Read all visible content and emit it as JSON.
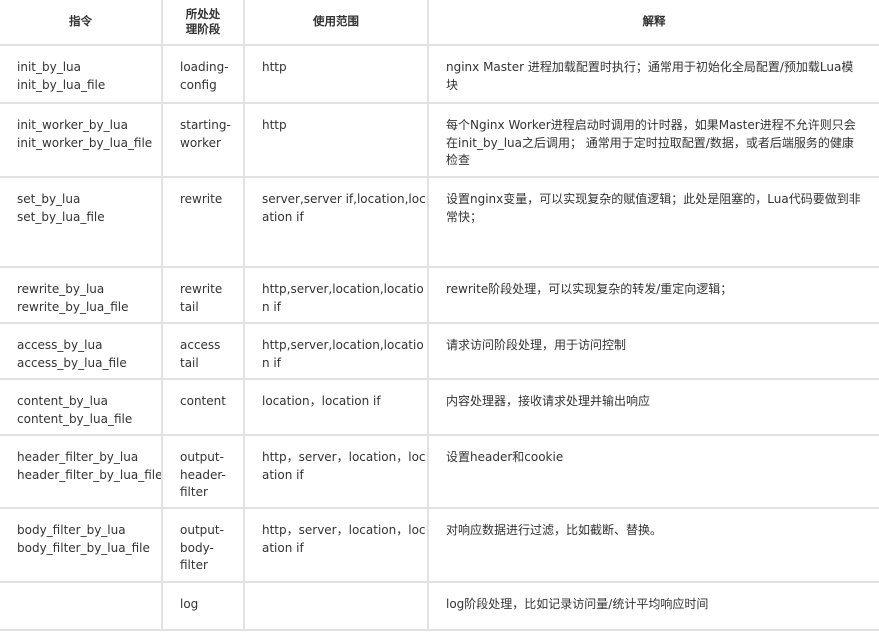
{
  "headers": {
    "directive": "指令",
    "phase": "所处处\n理阶段",
    "scope": "使用范围",
    "explain": "解释"
  },
  "rows": [
    {
      "d1": "init_by_lua",
      "d2": "init_by_lua_file",
      "phase": "loading-\nconfig",
      "scope": "http",
      "explain": "nginx Master 进程加载配置时执行；通常用于初始化全局配置/预加载Lua模块"
    },
    {
      "d1": "init_worker_by_lua",
      "d2": "init_worker_by_lua_file",
      "phase": "starting-\nworker",
      "scope": "http",
      "explain": "每个Nginx Worker进程启动时调用的计时器，如果Master进程不允许则只会在init_by_lua之后调用；  通常用于定时拉取配置/数据，或者后端服务的健康检查"
    },
    {
      "d1": "set_by_lua",
      "d2": "set_by_lua_file",
      "phase": "rewrite",
      "scope": "server,server if,location,location if",
      "explain": "设置nginx变量，可以实现复杂的赋值逻辑；此处是阻塞的，Lua代码要做到非常快；"
    },
    {
      "d1": "rewrite_by_lua",
      "d2": "rewrite_by_lua_file",
      "phase": "rewrite\ntail",
      "scope": "http,server,location,location if",
      "explain": "rewrite阶段处理，可以实现复杂的转发/重定向逻辑；"
    },
    {
      "d1": "access_by_lua",
      "d2": "access_by_lua_file",
      "phase": "access\ntail",
      "scope": "http,server,location,location if",
      "explain": "请求访问阶段处理，用于访问控制"
    },
    {
      "d1": "content_by_lua",
      "d2": "content_by_lua_file",
      "phase": "content",
      "scope": "location，location if",
      "explain": "内容处理器，接收请求处理并输出响应"
    },
    {
      "d1": "header_filter_by_lua",
      "d2": "header_filter_by_lua_file",
      "phase": "output-\nheader-\nfilter",
      "scope": "http，server，location，location if",
      "explain": "设置header和cookie"
    },
    {
      "d1": "body_filter_by_lua",
      "d2": "body_filter_by_lua_file",
      "phase": "output-\nbody-\nfilter",
      "scope": "http，server，location，location if",
      "explain": "对响应数据进行过滤，比如截断、替换。"
    },
    {
      "d1": "",
      "d2": "",
      "phase": "log",
      "scope": "",
      "explain": "log阶段处理，比如记录访问量/统计平均响应时间"
    }
  ]
}
